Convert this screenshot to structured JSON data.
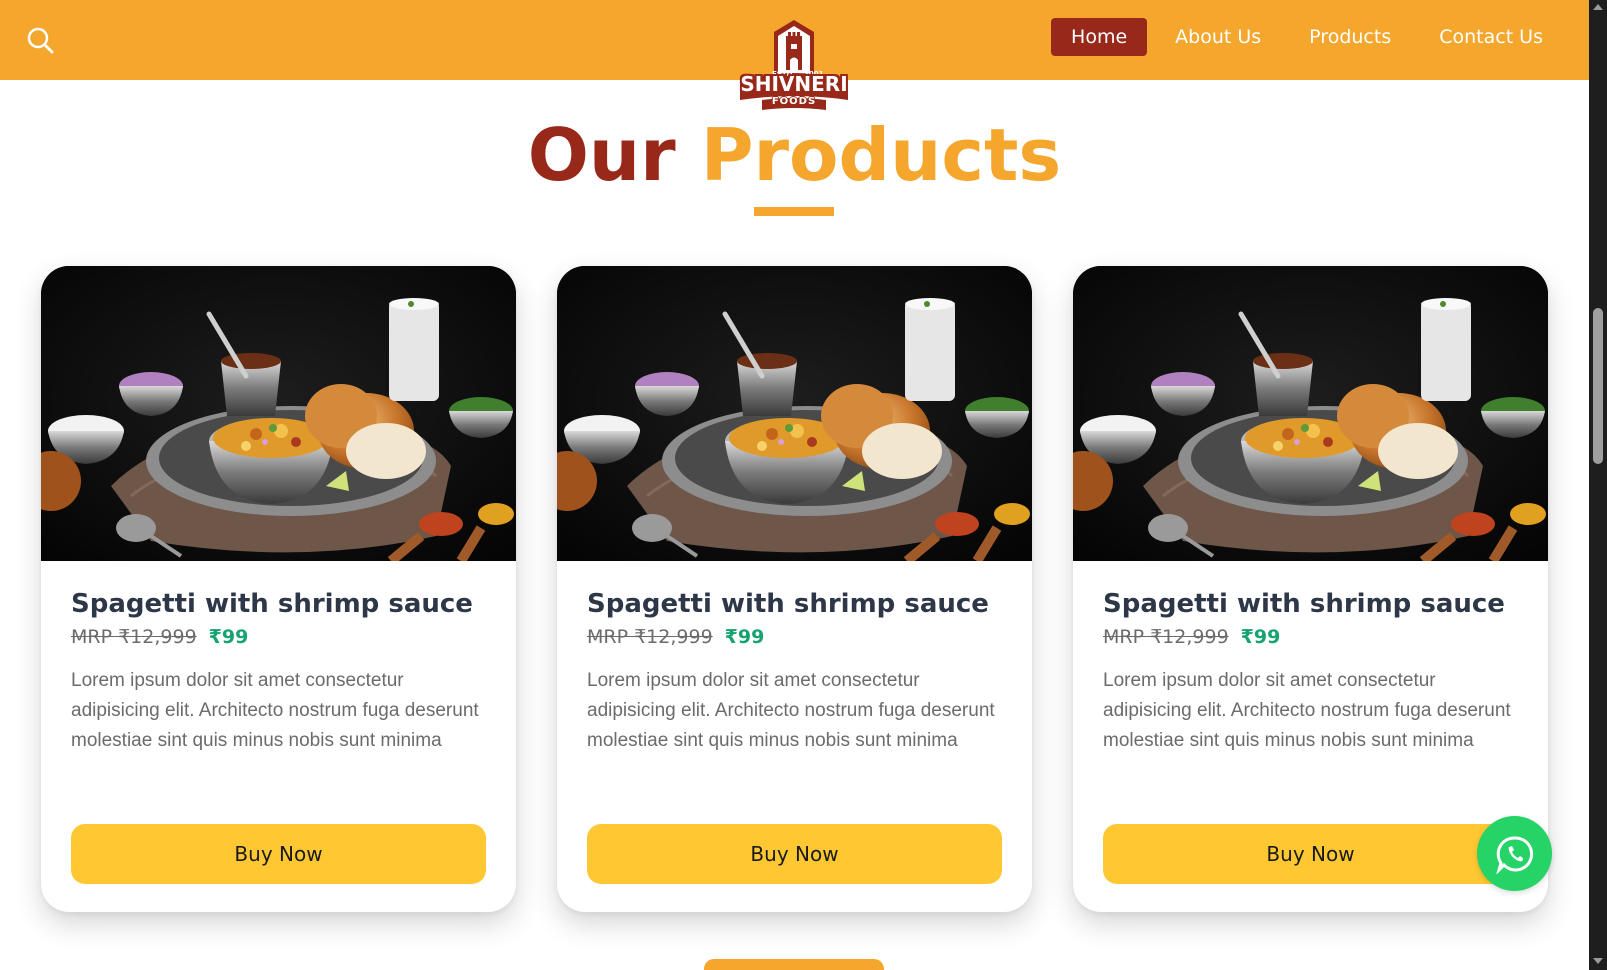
{
  "header": {
    "nav": [
      {
        "label": "Home",
        "active": true
      },
      {
        "label": "About Us",
        "active": false
      },
      {
        "label": "Products",
        "active": false
      },
      {
        "label": "Contact Us",
        "active": false
      }
    ],
    "logo": {
      "name": "SHIVNERI",
      "sub": "FOODS",
      "estd": "ESTD",
      "year": "2001"
    }
  },
  "section": {
    "title_part1": "Our",
    "title_part2": "Products"
  },
  "products": [
    {
      "title": "Spagetti with shrimp sauce",
      "mrp": "MRP ₹12,999",
      "price": "₹99",
      "description": "Lorem ipsum dolor sit amet consectetur adipisicing elit. Architecto nostrum fuga deserunt molestiae sint quis minus nobis sunt minima",
      "button": "Buy Now"
    },
    {
      "title": "Spagetti with shrimp sauce",
      "mrp": "MRP ₹12,999",
      "price": "₹99",
      "description": "Lorem ipsum dolor sit amet consectetur adipisicing elit. Architecto nostrum fuga deserunt molestiae sint quis minus nobis sunt minima",
      "button": "Buy Now"
    },
    {
      "title": "Spagetti with shrimp sauce",
      "mrp": "MRP ₹12,999",
      "price": "₹99",
      "description": "Lorem ipsum dolor sit amet consectetur adipisicing elit. Architecto nostrum fuga deserunt molestiae sint quis minus nobis sunt minima",
      "button": "Buy Now"
    }
  ],
  "colors": {
    "header_bg": "#f4a62d",
    "nav_active_bg": "#98281a",
    "title_dark": "#98281a",
    "title_accent": "#f4a62d",
    "price_green": "#16a36f",
    "button_yellow": "#ffc832",
    "whatsapp_green": "#25d366"
  },
  "icons": {
    "search": "search-icon",
    "whatsapp": "whatsapp-icon"
  }
}
